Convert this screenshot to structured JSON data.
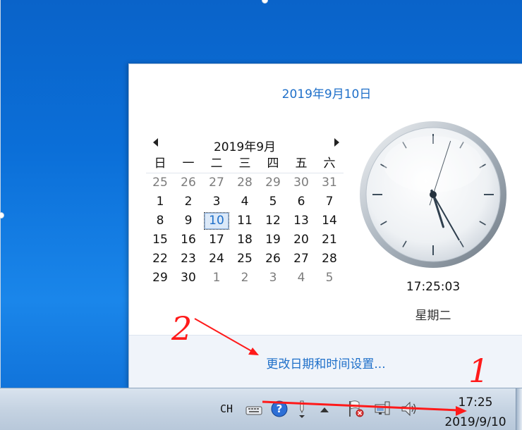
{
  "popup": {
    "long_date": "2019年9月10日",
    "calendar": {
      "month_title": "2019年9月",
      "weekdays": [
        "日",
        "一",
        "二",
        "三",
        "四",
        "五",
        "六"
      ],
      "weeks": [
        [
          {
            "d": "25",
            "other": true
          },
          {
            "d": "26",
            "other": true
          },
          {
            "d": "27",
            "other": true
          },
          {
            "d": "28",
            "other": true
          },
          {
            "d": "29",
            "other": true
          },
          {
            "d": "30",
            "other": true
          },
          {
            "d": "31",
            "other": true
          }
        ],
        [
          {
            "d": "1"
          },
          {
            "d": "2"
          },
          {
            "d": "3"
          },
          {
            "d": "4"
          },
          {
            "d": "5"
          },
          {
            "d": "6"
          },
          {
            "d": "7"
          }
        ],
        [
          {
            "d": "8"
          },
          {
            "d": "9"
          },
          {
            "d": "10",
            "today": true
          },
          {
            "d": "11"
          },
          {
            "d": "12"
          },
          {
            "d": "13"
          },
          {
            "d": "14"
          }
        ],
        [
          {
            "d": "15"
          },
          {
            "d": "16"
          },
          {
            "d": "17"
          },
          {
            "d": "18"
          },
          {
            "d": "19"
          },
          {
            "d": "20"
          },
          {
            "d": "21"
          }
        ],
        [
          {
            "d": "22"
          },
          {
            "d": "23"
          },
          {
            "d": "24"
          },
          {
            "d": "25"
          },
          {
            "d": "26"
          },
          {
            "d": "27"
          },
          {
            "d": "28"
          }
        ],
        [
          {
            "d": "29"
          },
          {
            "d": "30"
          },
          {
            "d": "1",
            "other": true
          },
          {
            "d": "2",
            "other": true
          },
          {
            "d": "3",
            "other": true
          },
          {
            "d": "4",
            "other": true
          },
          {
            "d": "5",
            "other": true
          }
        ]
      ]
    },
    "clock": {
      "hours": 17,
      "minutes": 25,
      "seconds": 3
    },
    "time_text": "17:25:03",
    "weekday_text": "星期二",
    "change_link": "更改日期和时间设置..."
  },
  "taskbar": {
    "language": "CH",
    "icons": [
      "keyboard-icon",
      "help-icon",
      "pen-icon",
      "show-hidden-icons-arrow",
      "network-flag-icon",
      "network-icon",
      "volume-icon"
    ],
    "time": "17:25",
    "date": "2019/9/10"
  },
  "annotations": {
    "label_1": "1",
    "label_2": "2",
    "color": "#ff1a1a"
  },
  "colors": {
    "accent": "#1e6fc9",
    "desktop": "#0b6fd8"
  }
}
